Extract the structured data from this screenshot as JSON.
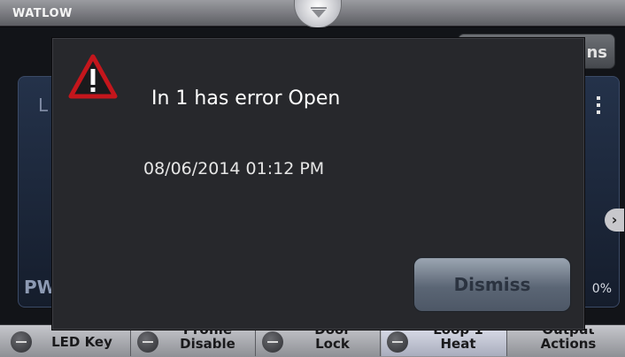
{
  "header": {
    "brand": "WATLOW",
    "pulltab_icon": "chevron-down-icon"
  },
  "background": {
    "top_button_label_fragment": "ns",
    "card_caption_fragment": "L",
    "power_label_fragment": "PW",
    "percent_value": "0%"
  },
  "dialog": {
    "icon": "warning-triangle-icon",
    "message": "In 1 has error Open",
    "timestamp": "08/06/2014 01:12 PM",
    "dismiss_label": "Dismiss"
  },
  "softkeys": [
    {
      "line1": "",
      "line2": "LED Key"
    },
    {
      "line1": "Profile",
      "line2": "Disable"
    },
    {
      "line1": "Door",
      "line2": "Lock"
    },
    {
      "line1": "Loop 1",
      "line2": "Heat"
    },
    {
      "line1": "Output",
      "line2": "Actions"
    }
  ],
  "colors": {
    "dialog_bg": "#27282c",
    "warning_red": "#c4161c",
    "button": "#5b6675"
  }
}
